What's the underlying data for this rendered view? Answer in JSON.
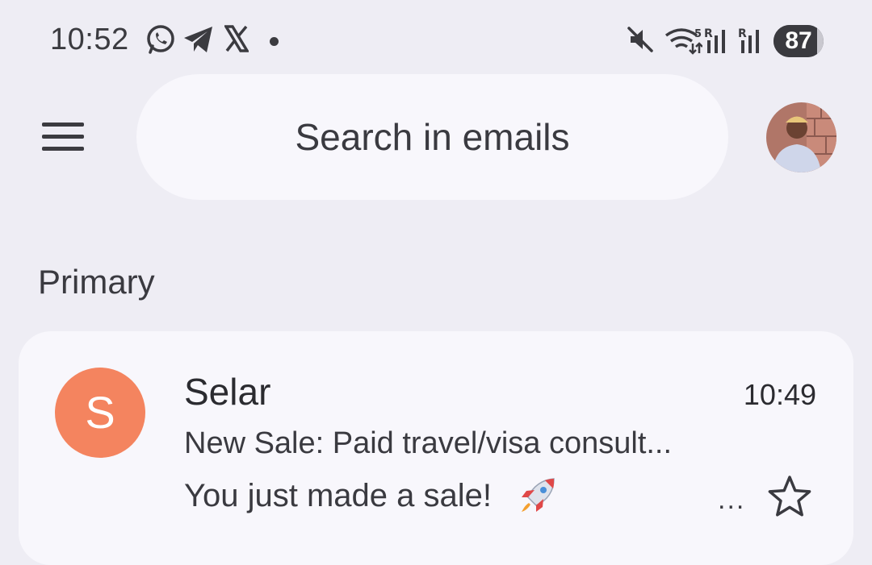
{
  "status_bar": {
    "time": "10:52",
    "battery": "87",
    "battery_level": 0.87,
    "left_icons": [
      "whatsapp-icon",
      "telegram-icon",
      "x-icon",
      "notification-dot"
    ],
    "right_icons": [
      "mute-icon",
      "wifi-icon",
      "signal-icon",
      "signal-icon"
    ]
  },
  "header": {
    "menu_icon": "hamburger-menu-icon",
    "search_placeholder": "Search in emails",
    "avatar": "account-avatar"
  },
  "section": {
    "title": "Primary"
  },
  "emails": [
    {
      "avatar_letter": "S",
      "avatar_color": "#f4845f",
      "sender": "Selar",
      "time": "10:49",
      "subject": "New Sale: Paid travel/visa consult...",
      "snippet": "You just made a sale!",
      "snippet_emoji": "rocket-icon",
      "more": "...",
      "starred": false
    }
  ],
  "colors": {
    "background": "#eeedf4",
    "surface": "#f8f7fc",
    "text": "#3a3a40"
  }
}
